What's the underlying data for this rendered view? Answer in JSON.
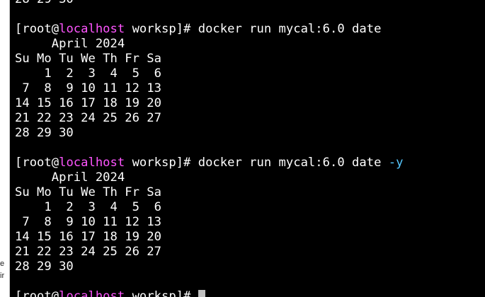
{
  "left_panel": {
    "fragments": [
      "e",
      "ir"
    ]
  },
  "prompt": {
    "open": "[root@",
    "host": "localhost",
    "cwd_close": " worksp]# "
  },
  "terminal": {
    "prev_tail": "28 29 30",
    "cmd1": "docker run mycal:6.0 date",
    "cmd2": "docker run mycal:6.0 date ",
    "cmd2_flag": "-y",
    "calendar": {
      "title": "     April 2024",
      "header": "Su Mo Tu We Th Fr Sa",
      "weeks": [
        "    1  2  3  4  5  6",
        " 7  8  9 10 11 12 13",
        "14 15 16 17 18 19 20",
        "21 22 23 24 25 26 27",
        "28 29 30"
      ]
    }
  },
  "colors": {
    "background": "#000000",
    "text": "#ffffff",
    "hostname": "#ff55ff",
    "flag": "#55c8ff",
    "cursor": "#c0c0c0"
  }
}
